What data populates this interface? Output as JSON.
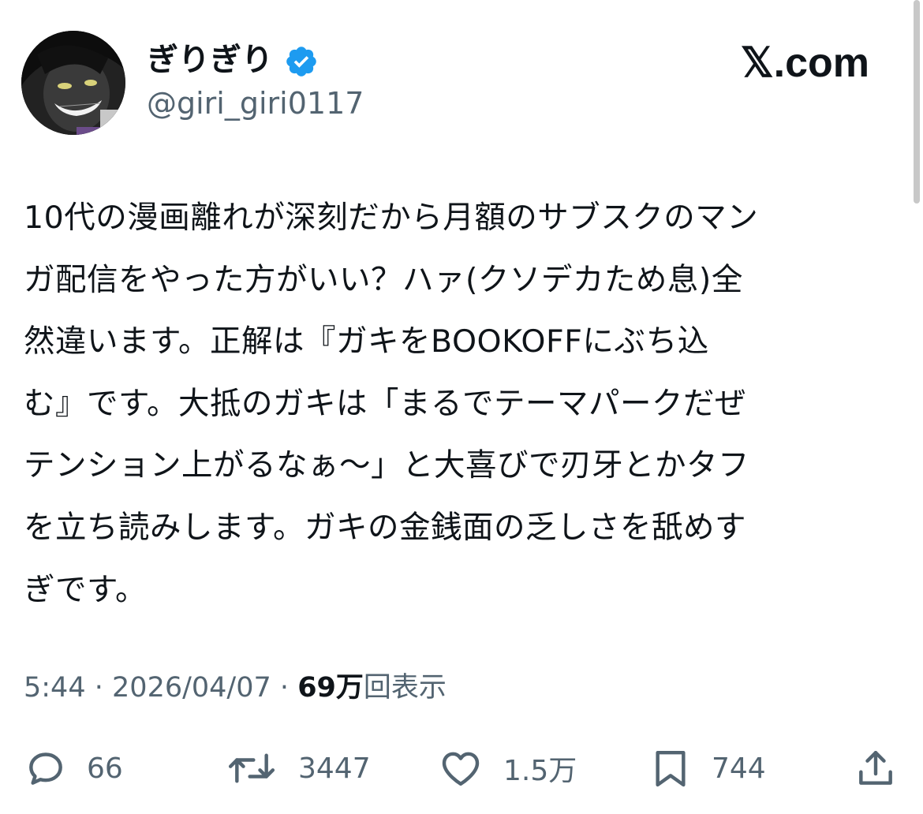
{
  "author": {
    "display_name": "ぎりぎり",
    "handle": "@giri_giri0117",
    "verified": true
  },
  "site": {
    "logo_text": "𝕏.com"
  },
  "tweet": {
    "text": "10代の漫画離れが深刻だから月額のサブスクのマン\nガ配信をやった方がいい？ハァ(クソデカため息)全\n然違います。正解は『ガキをBOOKOFFにぶち込\nむ』です。大抵のガキは「まるでテーマパークだぜ\nテンション上がるなぁ〜」と大喜びで刃牙とかタフ\nを立ち読みします。ガキの金銭面の乏しさを舐めす\nぎです。",
    "time": "5:44",
    "date": "2026/04/07",
    "separator": "·",
    "views_count": "69万",
    "views_label": "回表示"
  },
  "actions": {
    "reply_count": "66",
    "retweet_count": "3447",
    "like_count": "1.5万",
    "bookmark_count": "744"
  },
  "icons": {
    "verified": "verified-badge-icon",
    "reply": "speech-bubble-icon",
    "retweet": "retweet-arrows-icon",
    "like": "heart-icon",
    "bookmark": "bookmark-icon",
    "share": "share-upload-icon"
  },
  "colors": {
    "text": "#0f1419",
    "secondary": "#536471",
    "verified_blue": "#1d9bf0"
  }
}
